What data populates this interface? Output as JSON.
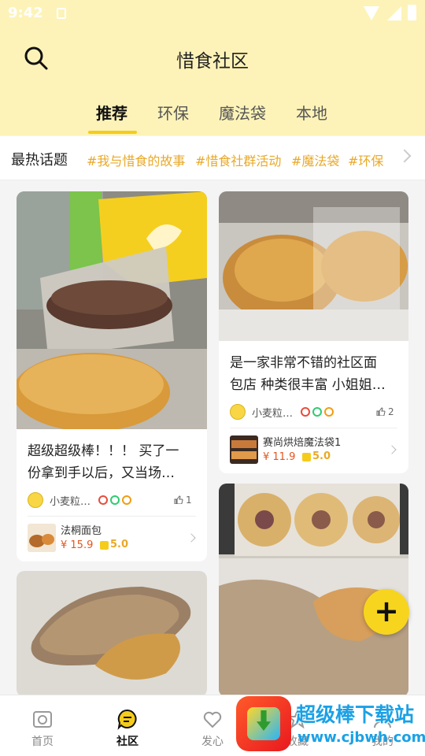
{
  "status_bar": {
    "time": "9:42"
  },
  "header": {
    "title": "惜食社区"
  },
  "tabs": [
    {
      "label": "推荐",
      "active": true
    },
    {
      "label": "环保",
      "active": false
    },
    {
      "label": "魔法袋",
      "active": false
    },
    {
      "label": "本地",
      "active": false
    }
  ],
  "topics": {
    "label": "最热话题",
    "tags": [
      "#我与惜食的故事",
      "#惜食社群活动",
      "#魔法袋",
      "#环保"
    ]
  },
  "posts": [
    {
      "title": "超级超级棒！！！ 买了一\n份拿到手以后，又当场…",
      "author": "小麦粒…",
      "likes": "1",
      "product": {
        "name": "法桐面包",
        "price": "¥ 15.9",
        "rating": "5.0"
      }
    },
    {
      "title": "是一家非常不错的社区面\n包店 种类很丰富 小姐姐…",
      "author": "小麦粒…",
      "likes": "2",
      "product": {
        "name": "赛尚烘焙魔法袋1",
        "price": "¥ 11.9",
        "rating": "5.0"
      }
    },
    {
      "photo": "bread-photo"
    },
    {
      "photo": "bagel-photo"
    }
  ],
  "fab": {
    "label": "+"
  },
  "bottom_nav": [
    {
      "label": "首页",
      "icon": "home-icon",
      "active": false
    },
    {
      "label": "社区",
      "icon": "community-icon",
      "active": true
    },
    {
      "label": "发心",
      "icon": "heart-icon",
      "active": false
    },
    {
      "label": "收藏",
      "icon": "favorites-icon",
      "active": false
    },
    {
      "label": "我的",
      "icon": "profile-icon",
      "active": false
    }
  ],
  "watermark": {
    "line1": "超级棒下载站",
    "line2": "www.cjbwh.com"
  },
  "colors": {
    "accent": "#f5cc1c",
    "header_bg": "#fdf3b8",
    "tag": "#e9a928",
    "price": "#e5551e"
  }
}
